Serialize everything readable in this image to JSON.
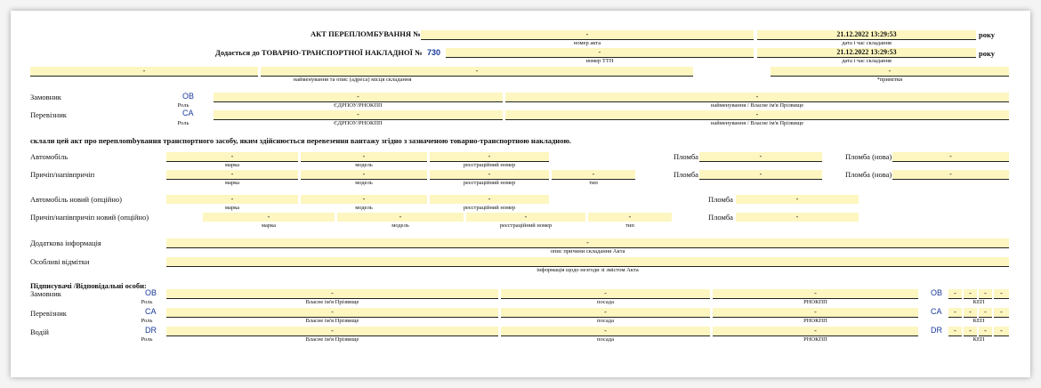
{
  "header": {
    "title": "АКТ ПЕРЕПЛОМБУВАННЯ №",
    "act_number": "-",
    "act_datetime": "21.12.2022 13:29:53",
    "year_word": "року",
    "cap_act_number": "номер акта",
    "cap_act_date": "дата і час складання",
    "ttn_title": "Додається до ТОВАРНО-ТРАНСПОРТНОЇ НАКЛАДНОЇ №",
    "ttn_code": "730",
    "ttn_number": "-",
    "ttn_datetime": "21.12.2022 13:29:53",
    "cap_ttn_number": "номер ТТН",
    "cap_ttn_date": "дата і час складання",
    "place_left": "-",
    "place_mid": "-",
    "place_right": "-",
    "cap_place": "найменування та опис (адреса) місця складання",
    "cap_notes": "*примітки"
  },
  "parties": {
    "customer_label": "Замовник",
    "customer_role": "OB",
    "customer_edrpou": "-",
    "customer_name": "-",
    "carrier_label": "Перевізник",
    "carrier_role": "CA",
    "carrier_edrpou": "-",
    "carrier_name": "-",
    "cap_role": "Роль",
    "cap_edrpou": "ЄДРПОУ/РНОКПП",
    "cap_name": "найменування / Власне ім'я Прізвище"
  },
  "statement": "склали цей акт про переплombування транспортного засобу, яким здійснюється перевезення вантажу згідно з зазначеною товарно-транспортною накладною.",
  "vehicles": {
    "car_label": "Автомобіль",
    "car_brand": "-",
    "car_model": "-",
    "car_reg": "-",
    "seal_label": "Пломба",
    "car_seal": "-",
    "seal_new_label": "Пломба (нова)",
    "car_seal_new": "-",
    "trailer_label": "Причіп/напівпричіп",
    "trailer_brand": "-",
    "trailer_model": "-",
    "trailer_reg": "-",
    "trailer_type": "-",
    "trailer_seal": "-",
    "trailer_seal_new": "-",
    "cap_brand": "марка",
    "cap_model": "модель",
    "cap_reg": "реєстраційний номер",
    "cap_type": "тип",
    "newcar_label": "Автомобіль новий (опційно)",
    "newcar_brand": "-",
    "newcar_model": "-",
    "newcar_reg": "-",
    "newcar_seal": "-",
    "newtrailer_label": "Причіп/напівпричіп новий (опційно)",
    "newtrailer_brand": "-",
    "newtrailer_model": "-",
    "newtrailer_reg": "-",
    "newtrailer_type": "-",
    "newtrailer_seal": "-"
  },
  "extra": {
    "info_label": "Додаткова інформація",
    "info_value": "-",
    "cap_info": "опис причини складання Акта",
    "notes_label": "Особливі відмітки",
    "notes_value": "",
    "cap_notes": "інформація щодо незгоди зі змістом Акта"
  },
  "signers": {
    "title": "Підписувачі /Відповідальні особи:",
    "cap_role": "Роль",
    "cap_name": "Власне ім'я Прізвище",
    "cap_position": "посада",
    "cap_rnokpp": "РНОКПП",
    "cap_kep": "КЕП",
    "rows": [
      {
        "label": "Замовник",
        "role": "OB",
        "name": "-",
        "position": "-",
        "rnokpp": "-",
        "kep_role": "OB",
        "k1": "-",
        "k2": "-",
        "k3": "-",
        "k4": "-"
      },
      {
        "label": "Перевізник",
        "role": "CA",
        "name": "-",
        "position": "-",
        "rnokpp": "-",
        "kep_role": "CA",
        "k1": "-",
        "k2": "-",
        "k3": "-",
        "k4": "-"
      },
      {
        "label": "Водій",
        "role": "DR",
        "name": "-",
        "position": "-",
        "rnokpp": "-",
        "kep_role": "DR",
        "k1": "-",
        "k2": "-",
        "k3": "-",
        "k4": "-"
      }
    ]
  },
  "colors": {
    "field_bg": "#fdf6c0",
    "role_blue": "#1a3a9a"
  }
}
